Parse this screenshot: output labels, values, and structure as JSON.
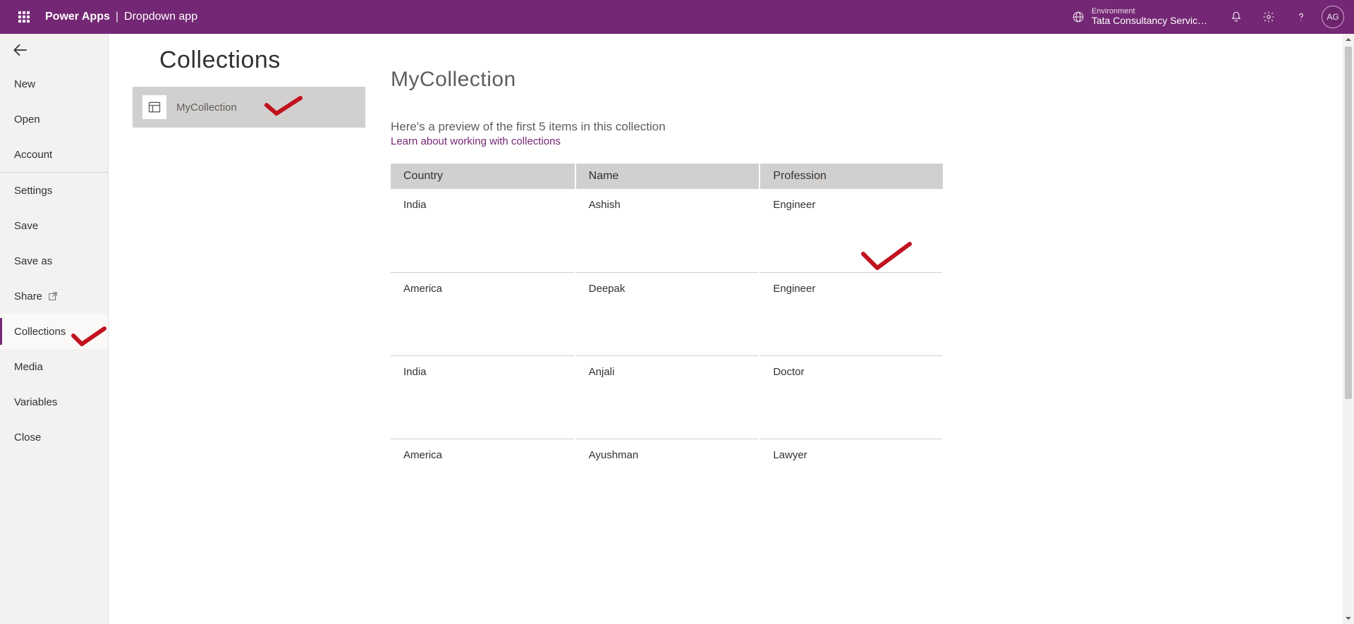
{
  "header": {
    "brand": "Power Apps",
    "separator": "|",
    "app_name": "Dropdown app",
    "environment_label": "Environment",
    "environment_value": "Tata Consultancy Servic…",
    "avatar_initials": "AG"
  },
  "leftnav": {
    "items": [
      {
        "label": "New"
      },
      {
        "label": "Open"
      },
      {
        "label": "Account"
      },
      {
        "label": "Settings"
      },
      {
        "label": "Save"
      },
      {
        "label": "Save as"
      },
      {
        "label": "Share"
      },
      {
        "label": "Collections"
      },
      {
        "label": "Media"
      },
      {
        "label": "Variables"
      },
      {
        "label": "Close"
      }
    ]
  },
  "page": {
    "title": "Collections",
    "collections_list": [
      {
        "label": "MyCollection"
      }
    ]
  },
  "detail": {
    "title": "MyCollection",
    "preview_text": "Here's a preview of the first 5 items in this collection",
    "learn_link": "Learn about working with collections",
    "columns": [
      "Country",
      "Name",
      "Profession"
    ],
    "rows": [
      {
        "Country": "India",
        "Name": "Ashish",
        "Profession": "Engineer"
      },
      {
        "Country": "America",
        "Name": "Deepak",
        "Profession": "Engineer"
      },
      {
        "Country": "India",
        "Name": "Anjali",
        "Profession": "Doctor"
      },
      {
        "Country": "America",
        "Name": "Ayushman",
        "Profession": "Lawyer"
      }
    ]
  }
}
